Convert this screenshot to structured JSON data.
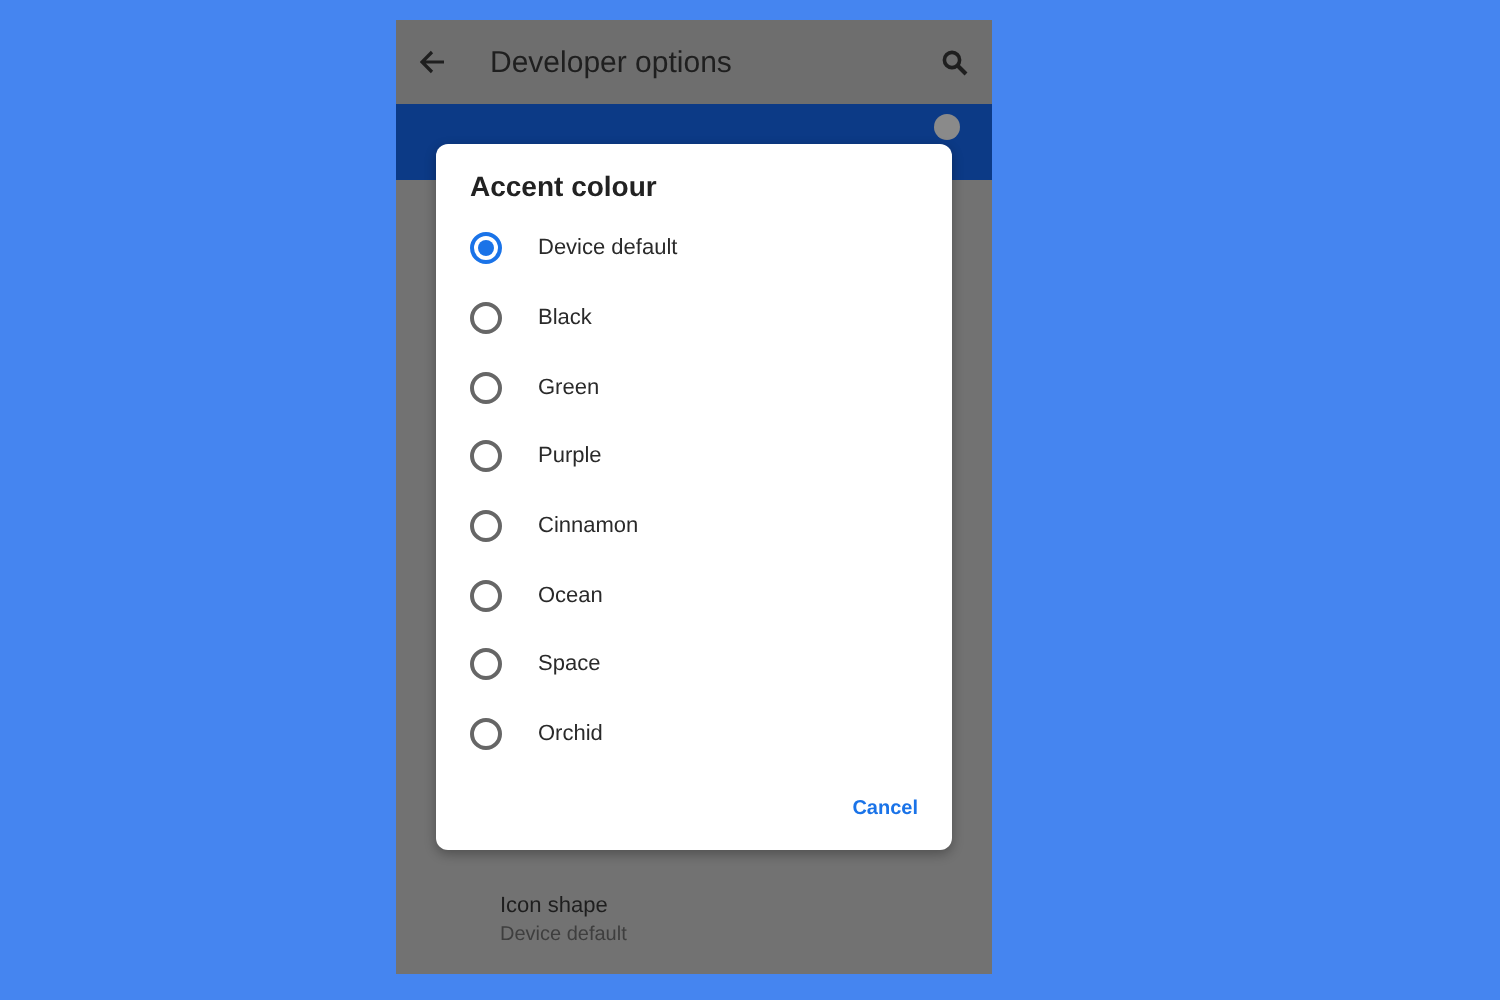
{
  "app_bar": {
    "title": "Developer options"
  },
  "settings_items": [
    {
      "title": "Icon shape",
      "summary": "Device default"
    }
  ],
  "dialog": {
    "title": "Accent colour",
    "options": [
      {
        "label": "Device default",
        "selected": true
      },
      {
        "label": "Black",
        "selected": false
      },
      {
        "label": "Green",
        "selected": false
      },
      {
        "label": "Purple",
        "selected": false
      },
      {
        "label": "Cinnamon",
        "selected": false
      },
      {
        "label": "Ocean",
        "selected": false
      },
      {
        "label": "Space",
        "selected": false
      },
      {
        "label": "Orchid",
        "selected": false
      }
    ],
    "buttons": [
      "Cancel"
    ]
  }
}
